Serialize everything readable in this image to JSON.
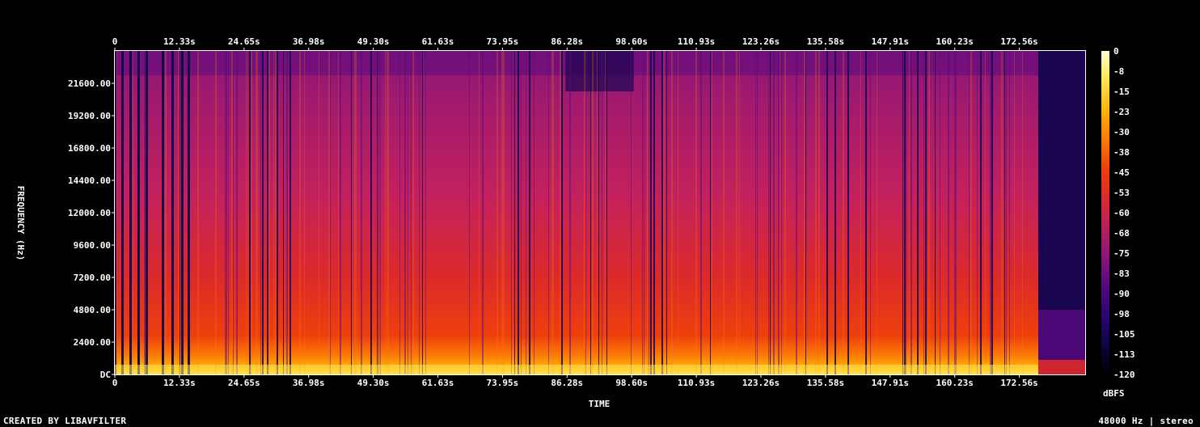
{
  "chart_data": {
    "type": "heatmap",
    "subtype": "spectrogram",
    "xlabel": "TIME",
    "ylabel": "FREQUENCY (Hz)",
    "x_ticks": [
      "0",
      "12.33s",
      "24.65s",
      "36.98s",
      "49.30s",
      "61.63s",
      "73.95s",
      "86.28s",
      "98.60s",
      "110.93s",
      "123.26s",
      "135.58s",
      "147.91s",
      "160.23s",
      "172.56s"
    ],
    "y_ticks": [
      "DC",
      "2400.00",
      "4800.00",
      "7200.00",
      "9600.00",
      "12000.00",
      "14400.00",
      "16800.00",
      "19200.00",
      "21600.00"
    ],
    "xlim_seconds": [
      0,
      184.9
    ],
    "ylim_hz": [
      0,
      24000
    ],
    "colorbar": {
      "label": "dBFS",
      "ticks": [
        "0",
        "-8",
        "-15",
        "-23",
        "-30",
        "-38",
        "-45",
        "-53",
        "-60",
        "-68",
        "-75",
        "-83",
        "-90",
        "-98",
        "-105",
        "-113",
        "-120"
      ],
      "range_dbfs": [
        -120,
        0
      ],
      "colors": [
        "#000000",
        "#0b0545",
        "#2c0570",
        "#55097f",
        "#8a157a",
        "#b8205e",
        "#dc2a2a",
        "#ee3f0d",
        "#fc7a06",
        "#fcb40d",
        "#fde352",
        "#fffdd0"
      ]
    }
  },
  "footer": {
    "left": "CREATED BY LIBAVFILTER",
    "right": "48000 Hz | stereo"
  }
}
